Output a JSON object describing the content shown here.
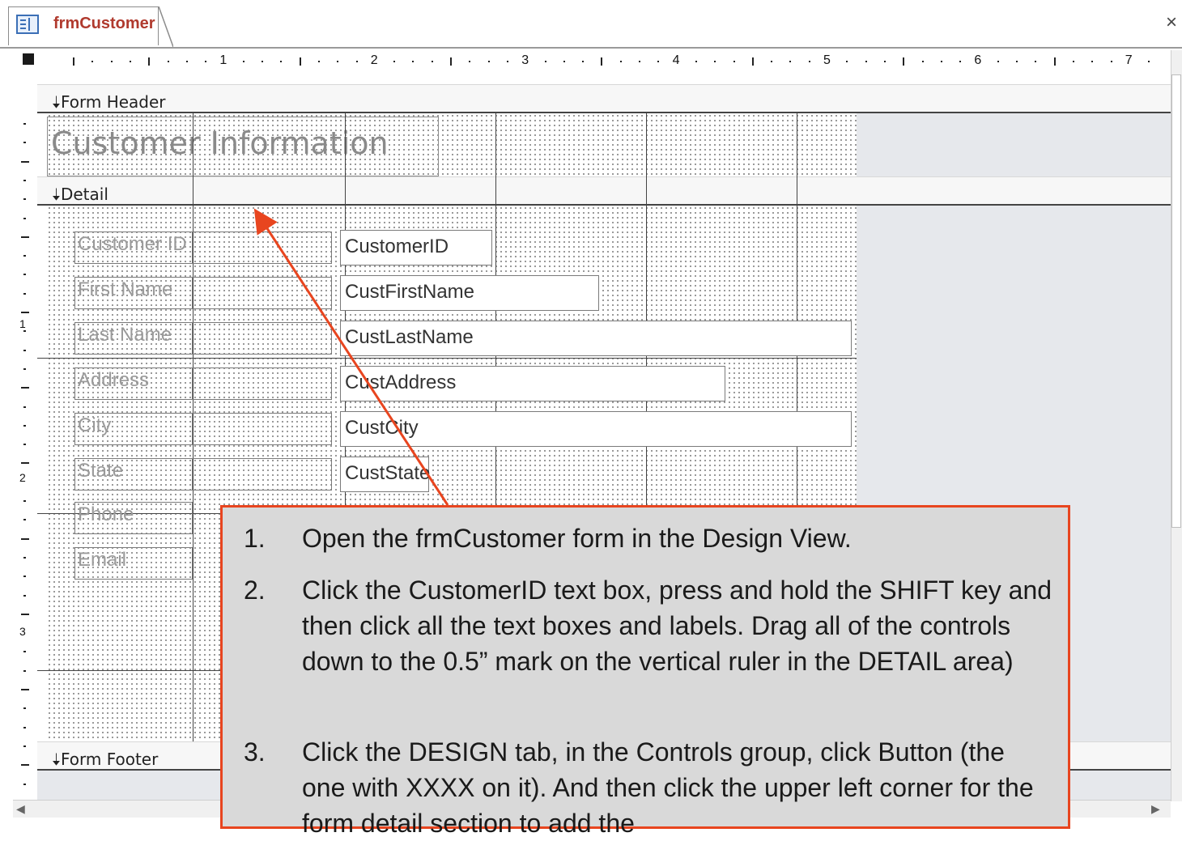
{
  "tab": {
    "title": "frmCustomer",
    "icon": "form-icon",
    "close": "×"
  },
  "rulers": {
    "horizontal_marks": [
      "1",
      "2",
      "3",
      "4",
      "5",
      "6",
      "7"
    ],
    "vertical_marks": [
      "1",
      "2",
      "3"
    ]
  },
  "sections": {
    "header": "Form Header",
    "detail": "Detail",
    "footer": "Form Footer"
  },
  "form_title": "Customer Information",
  "fields": [
    {
      "label": "Customer ID",
      "control": "CustomerID"
    },
    {
      "label": "First Name",
      "control": "CustFirstName"
    },
    {
      "label": "Last Name",
      "control": "CustLastName"
    },
    {
      "label": "Address",
      "control": "CustAddress"
    },
    {
      "label": "City",
      "control": "CustCity"
    },
    {
      "label": "State",
      "control": "CustState"
    },
    {
      "label": "Phone",
      "control": ""
    },
    {
      "label": "Email",
      "control": ""
    }
  ],
  "instructions": [
    {
      "num": "1.",
      "text": "Open the frmCustomer form in the Design View."
    },
    {
      "num": "2.",
      "text": "Click the CustomerID text box, press and hold the SHIFT key and then click all the text boxes and labels. Drag all of the controls down to the 0.5” mark on the vertical ruler in the DETAIL area)"
    },
    {
      "num": "3.",
      "text": "Click the DESIGN tab, in the Controls group, click Button (the one with XXXX on it). And then click the upper left corner for the form detail section to add the"
    }
  ],
  "colors": {
    "callout_border": "#e8451f",
    "callout_bg": "#d9d9d9",
    "arrow": "#e8451f",
    "tab_title": "#b03a2e"
  }
}
